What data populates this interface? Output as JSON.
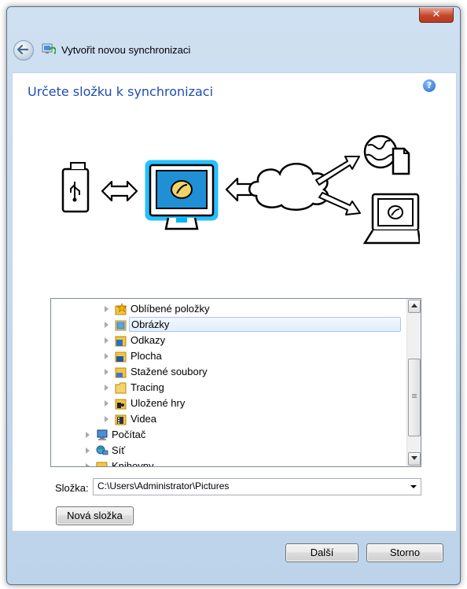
{
  "window": {
    "close_label": "✕",
    "title": "Vytvořit novou synchronizaci"
  },
  "page": {
    "heading": "Určete složku k synchronizaci",
    "help_label": "?"
  },
  "tree": {
    "items": [
      {
        "label": "Oblíbené položky",
        "icon": "favorites-star-folder-icon"
      },
      {
        "label": "Obrázky",
        "icon": "pictures-folder-icon"
      },
      {
        "label": "Odkazy",
        "icon": "links-folder-icon"
      },
      {
        "label": "Plocha",
        "icon": "desktop-folder-icon"
      },
      {
        "label": "Stažené soubory",
        "icon": "downloads-folder-icon"
      },
      {
        "label": "Tracing",
        "icon": "folder-icon"
      },
      {
        "label": "Uložené hry",
        "icon": "saved-games-folder-icon"
      },
      {
        "label": "Videa",
        "icon": "videos-folder-icon"
      },
      {
        "label": "Počítač",
        "icon": "computer-icon"
      },
      {
        "label": "Síť",
        "icon": "network-icon"
      },
      {
        "label": "Knihovny",
        "icon": "libraries-folder-icon"
      }
    ]
  },
  "folder": {
    "label": "Složka:",
    "value": "C:\\Users\\Administrator\\Pictures"
  },
  "buttons": {
    "new_folder": "Nová složka",
    "next": "Další",
    "cancel": "Storno"
  }
}
